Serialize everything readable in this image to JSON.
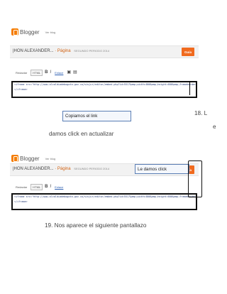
{
  "screenshot1": {
    "brand": "Blogger",
    "user_label": "Ver blog",
    "blog_title": "|HON ALEXANDER...",
    "page_word": "· Página",
    "blog_subtitle": "SEGUNDO PERIODO 2014",
    "action_button": "Guía",
    "tab_compose": "Redactar",
    "tab_html": "HTML",
    "tool_bold": "B",
    "tool_italic": "I",
    "tool_link": "Enlace",
    "tool_image": "▣",
    "tool_video": "▤",
    "code_line_1": "<iframe src=\"http://www.alcaldiadebogota.gov.co/sisjur/editor/embed.php?id=5517&amp;width=800&amp;height=600&amp;frameborder=0&amp;allowfullscreen=true&amp;showinfo=0&amp;mozallowfullscreen=true&amp;webkitallowfullscreen=true&amp;scrolling=no\" style=\"width:800px\">",
    "code_line_2": "</iframe>",
    "callout": "Copiamos el link"
  },
  "step18_number": "18.  L",
  "step18_wrap": "e",
  "step18_text": "damos click en actualizar",
  "screenshot2": {
    "brand": "Blogger",
    "user_label": "Ver blog",
    "blog_title": "|HON ALEXANDER...",
    "page_word": "· Página",
    "blog_subtitle": "SEGUNDO PERIODO 2014",
    "action_button": "Guía",
    "tab_compose": "Redactar",
    "tab_html": "HTML",
    "tool_bold": "B",
    "tool_italic": "I",
    "tool_link": "Enlace",
    "code_line_1": "<iframe src=\"http://www.alcaldiadebogota.gov.co/sisjur/editor/embed.php?id=5517&amp;width=800&amp;height=600&amp;frameborder=0&amp;allowfullscreen=true&amp;showinfo=0&amp;mozallowfullscreen=true&amp;webkitallowfullscreen=true&amp;scrolling=no\" style=\"width:800px\">",
    "code_line_2": "</iframe>",
    "callout": "Le damos click"
  },
  "step19_text": "19.  Nos aparece el siguiente pantallazo"
}
